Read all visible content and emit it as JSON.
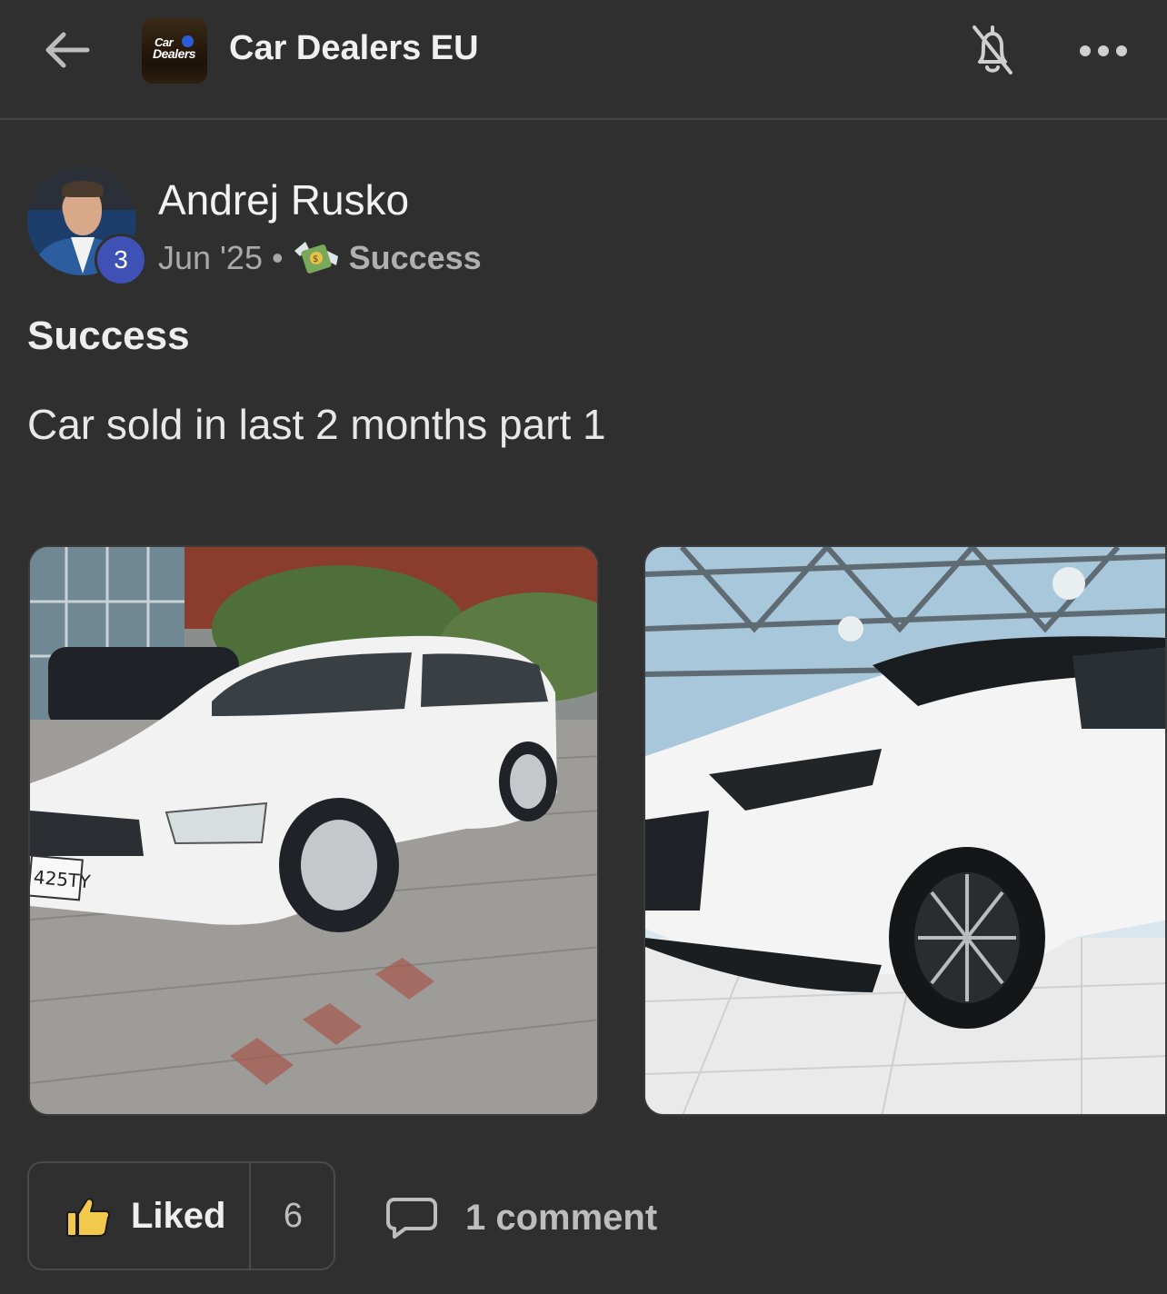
{
  "header": {
    "group_name": "Car Dealers EU",
    "logo_text_line1": "Car",
    "logo_text_line2": "Dealers",
    "icons": [
      "back-arrow-icon",
      "bell-off-icon",
      "more-options-icon"
    ]
  },
  "post": {
    "author": "Andrej Rusko",
    "level": "3",
    "date": "Jun '25",
    "separator": "•",
    "category": "Success",
    "category_icon": "money-with-wings-icon",
    "title": "Success",
    "body": "Car sold in last 2 months part 1",
    "images": [
      "white-station-wagon-photo",
      "white-suv-showroom-photo"
    ],
    "plate_text": "425TY"
  },
  "actions": {
    "like_label": "Liked",
    "like_count": "6",
    "comments_label": "1 comment"
  },
  "colors": {
    "background": "#2f2f2f",
    "text": "#e9e9e9",
    "muted": "#a9a9a9",
    "level_badge": "#3f51b5",
    "thumb": "#f2c94c"
  }
}
